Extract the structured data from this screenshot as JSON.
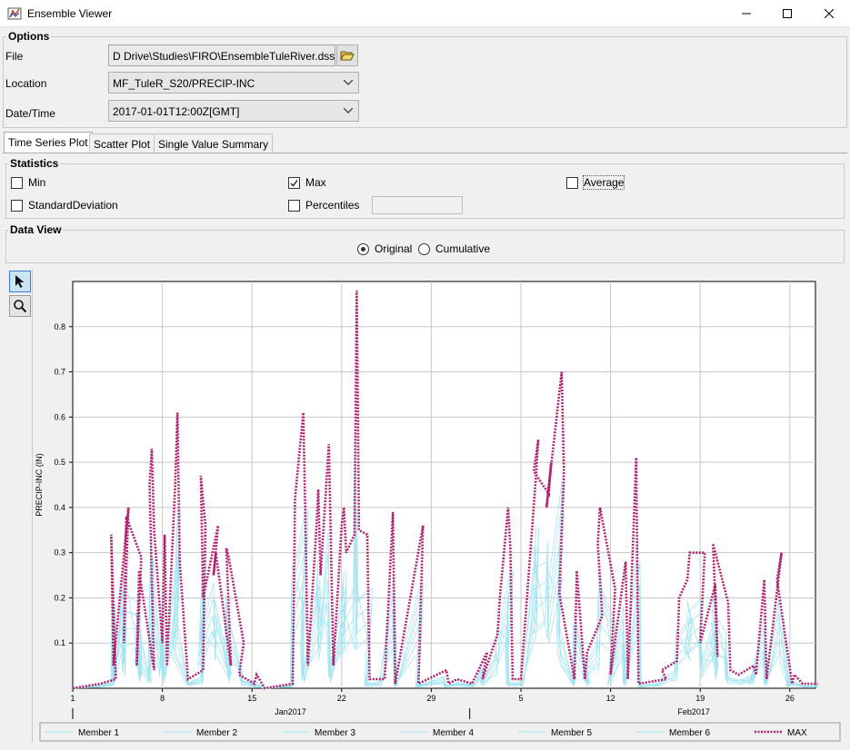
{
  "window": {
    "title": "Ensemble Viewer"
  },
  "options": {
    "group_title": "Options",
    "file_label": "File",
    "file_value": "D Drive\\Studies\\FIRO\\EnsembleTuleRiver.dss",
    "location_label": "Location",
    "location_value": "MF_TuleR_S20/PRECIP-INC",
    "datetime_label": "Date/Time",
    "datetime_value": "2017-01-01T12:00Z[GMT]"
  },
  "tabs": [
    {
      "label": "Time Series Plot",
      "active": true
    },
    {
      "label": "Scatter Plot",
      "active": false
    },
    {
      "label": "Single Value Summary",
      "active": false
    }
  ],
  "statistics": {
    "group_title": "Statistics",
    "min": {
      "label": "Min",
      "checked": false
    },
    "max": {
      "label": "Max",
      "checked": true
    },
    "average": {
      "label": "Average",
      "checked": false
    },
    "stddev": {
      "label": "StandardDeviation",
      "checked": false
    },
    "percentiles": {
      "label": "Percentiles",
      "checked": false,
      "value": ""
    }
  },
  "data_view": {
    "group_title": "Data View",
    "original_label": "Original",
    "cumulative_label": "Cumulative",
    "selected": "Original"
  },
  "toolbar": {
    "pointer_icon": "pointer-icon",
    "zoom_icon": "zoom-icon"
  },
  "chart_data": {
    "type": "line",
    "ylabel": "PRECIP-INC (IN)",
    "ylim": [
      0,
      0.9
    ],
    "yticks": [
      "0.1",
      "0.2",
      "0.3",
      "0.4",
      "0.5",
      "0.6",
      "0.7",
      "0.8"
    ],
    "xticks": [
      "1",
      "8",
      "15",
      "22",
      "29",
      "5",
      "12",
      "19",
      "26"
    ],
    "xgroups": [
      "Jan2017",
      "Feb2017"
    ],
    "x_start": "2017-01-01",
    "x_end": "2017-02-28",
    "grid": true,
    "legend_position": "bottom",
    "colors": {
      "max": "#b3206e",
      "members": "#9fe3f2"
    },
    "series": [
      {
        "name": "Member 1",
        "style": "thin-solid"
      },
      {
        "name": "Member 2",
        "style": "thin-solid"
      },
      {
        "name": "Member 3",
        "style": "thin-solid"
      },
      {
        "name": "Member 4",
        "style": "thin-solid"
      },
      {
        "name": "Member 5",
        "style": "thin-solid"
      },
      {
        "name": "Member 6",
        "style": "thin-solid"
      },
      {
        "name": "MAX",
        "style": "dotted-thick",
        "points": [
          [
            "2017-01-01",
            0
          ],
          [
            "2017-01-03",
            0.01
          ],
          [
            "2017-01-04",
            0.02
          ],
          [
            "2017-01-04",
            0.34
          ],
          [
            "2017-01-04",
            0.05
          ],
          [
            "2017-01-05",
            0.4
          ],
          [
            "2017-01-05",
            0.1
          ],
          [
            "2017-01-05",
            0.38
          ],
          [
            "2017-01-06",
            0.29
          ],
          [
            "2017-01-06",
            0.05
          ],
          [
            "2017-01-06",
            0.26
          ],
          [
            "2017-01-07",
            0.04
          ],
          [
            "2017-01-07",
            0.45
          ],
          [
            "2017-01-07",
            0.53
          ],
          [
            "2017-01-07",
            0.35
          ],
          [
            "2017-01-08",
            0.1
          ],
          [
            "2017-01-08",
            0.34
          ],
          [
            "2017-01-08",
            0.05
          ],
          [
            "2017-01-09",
            0.45
          ],
          [
            "2017-01-09",
            0.61
          ],
          [
            "2017-01-09",
            0.28
          ],
          [
            "2017-01-10",
            0.02
          ],
          [
            "2017-01-11",
            0.04
          ],
          [
            "2017-01-11",
            0.36
          ],
          [
            "2017-01-11",
            0.47
          ],
          [
            "2017-01-11",
            0.2
          ],
          [
            "2017-01-12",
            0.36
          ],
          [
            "2017-01-12",
            0.25
          ],
          [
            "2017-01-12",
            0.3
          ],
          [
            "2017-01-13",
            0.05
          ],
          [
            "2017-01-13",
            0.31
          ],
          [
            "2017-01-13",
            0.29
          ],
          [
            "2017-01-14",
            0.1
          ],
          [
            "2017-01-14",
            0.03
          ],
          [
            "2017-01-15",
            0.01
          ],
          [
            "2017-01-15",
            0.03
          ],
          [
            "2017-01-16",
            0.0
          ],
          [
            "2017-01-18",
            0.01
          ],
          [
            "2017-01-18",
            0.42
          ],
          [
            "2017-01-19",
            0.61
          ],
          [
            "2017-01-19",
            0.36
          ],
          [
            "2017-01-19",
            0.05
          ],
          [
            "2017-01-20",
            0.34
          ],
          [
            "2017-01-20",
            0.44
          ],
          [
            "2017-01-20",
            0.25
          ],
          [
            "2017-01-21",
            0.54
          ],
          [
            "2017-01-21",
            0.3
          ],
          [
            "2017-01-21",
            0.05
          ],
          [
            "2017-01-22",
            0.36
          ],
          [
            "2017-01-22",
            0.4
          ],
          [
            "2017-01-22",
            0.3
          ],
          [
            "2017-01-23",
            0.34
          ],
          [
            "2017-01-23",
            0.88
          ],
          [
            "2017-01-23",
            0.35
          ],
          [
            "2017-01-24",
            0.34
          ],
          [
            "2017-01-24",
            0.02
          ],
          [
            "2017-01-25",
            0.02
          ],
          [
            "2017-01-26",
            0.39
          ],
          [
            "2017-01-26",
            0.01
          ],
          [
            "2017-01-28",
            0.36
          ],
          [
            "2017-01-28",
            0.01
          ],
          [
            "2017-01-30",
            0.04
          ],
          [
            "2017-01-30",
            0.01
          ],
          [
            "2017-01-31",
            0.02
          ],
          [
            "2017-02-01",
            0.01
          ],
          [
            "2017-02-02",
            0.08
          ],
          [
            "2017-02-02",
            0.02
          ],
          [
            "2017-02-03",
            0.12
          ],
          [
            "2017-02-03",
            0.2
          ],
          [
            "2017-02-04",
            0.4
          ],
          [
            "2017-02-04",
            0.31
          ],
          [
            "2017-02-04",
            0.02
          ],
          [
            "2017-02-05",
            0.02
          ],
          [
            "2017-02-06",
            0.47
          ],
          [
            "2017-02-06",
            0.55
          ],
          [
            "2017-02-06",
            0.48
          ],
          [
            "2017-02-07",
            0.43
          ],
          [
            "2017-02-07",
            0.5
          ],
          [
            "2017-02-07",
            0.4
          ],
          [
            "2017-02-08",
            0.7
          ],
          [
            "2017-02-08",
            0.48
          ],
          [
            "2017-02-08",
            0.21
          ],
          [
            "2017-02-09",
            0.02
          ],
          [
            "2017-02-09",
            0.26
          ],
          [
            "2017-02-10",
            0.02
          ],
          [
            "2017-02-10",
            0.08
          ],
          [
            "2017-02-11",
            0.16
          ],
          [
            "2017-02-11",
            0.32
          ],
          [
            "2017-02-11",
            0.4
          ],
          [
            "2017-02-12",
            0.22
          ],
          [
            "2017-02-12",
            0.03
          ],
          [
            "2017-02-13",
            0.28
          ],
          [
            "2017-02-13",
            0.02
          ],
          [
            "2017-02-14",
            0.51
          ],
          [
            "2017-02-14",
            0.01
          ],
          [
            "2017-02-16",
            0.02
          ],
          [
            "2017-02-16",
            0.04
          ],
          [
            "2017-02-17",
            0.06
          ],
          [
            "2017-02-17",
            0.2
          ],
          [
            "2017-02-18",
            0.24
          ],
          [
            "2017-02-18",
            0.3
          ],
          [
            "2017-02-19",
            0.3
          ],
          [
            "2017-02-19",
            0.1
          ],
          [
            "2017-02-20",
            0.23
          ],
          [
            "2017-02-20",
            0.07
          ],
          [
            "2017-02-20",
            0.32
          ],
          [
            "2017-02-21",
            0.19
          ],
          [
            "2017-02-21",
            0.04
          ],
          [
            "2017-02-22",
            0.03
          ],
          [
            "2017-02-23",
            0.05
          ],
          [
            "2017-02-23",
            0.03
          ],
          [
            "2017-02-24",
            0.24
          ],
          [
            "2017-02-24",
            0.02
          ],
          [
            "2017-02-25",
            0.3
          ],
          [
            "2017-02-25",
            0.24
          ],
          [
            "2017-02-26",
            0.01
          ],
          [
            "2017-02-26",
            0.03
          ],
          [
            "2017-02-27",
            0.01
          ],
          [
            "2017-02-28",
            0.01
          ]
        ]
      }
    ]
  }
}
